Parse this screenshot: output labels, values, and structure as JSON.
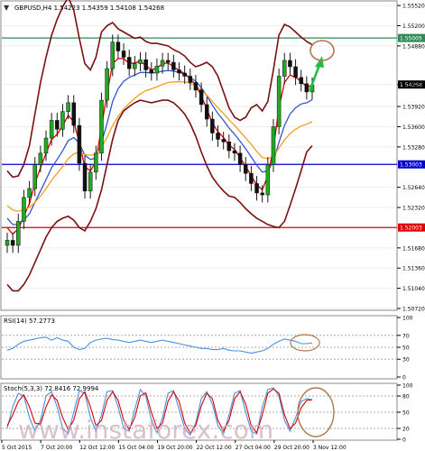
{
  "chart_data": [
    {
      "type": "candlestick",
      "panel": "main",
      "title": "GBPUSD,H4  1.54223 1.54359 1.54108 1.54268",
      "ylim": [
        1.5072,
        1.5555
      ],
      "y_ticks": [
        {
          "label": "1.55520",
          "value": 1.5552
        },
        {
          "label": "1.55200",
          "value": 1.552
        },
        {
          "label": "1.54880",
          "value": 1.5488
        },
        {
          "label": "1.54268",
          "value": 1.54268
        },
        {
          "label": "1.53920",
          "value": 1.5392
        },
        {
          "label": "1.53600",
          "value": 1.536
        },
        {
          "label": "1.53280",
          "value": 1.5328
        },
        {
          "label": "1.52640",
          "value": 1.5264
        },
        {
          "label": "1.52320",
          "value": 1.5232
        },
        {
          "label": "1.51680",
          "value": 1.5168
        },
        {
          "label": "1.51360",
          "value": 1.5136
        },
        {
          "label": "1.51040",
          "value": 1.5104
        },
        {
          "label": "1.50720",
          "value": 1.5072
        }
      ],
      "hlines": [
        {
          "label": "1.55005",
          "value": 1.55005,
          "color": "#2e8b57"
        },
        {
          "label": "1.53003",
          "value": 1.53003,
          "color": "#0000cc"
        },
        {
          "label": "1.52003",
          "value": 1.52003,
          "color": "#dd0000"
        }
      ],
      "current_price": {
        "label": "1.54268",
        "value": 1.54268
      },
      "series": [
        {
          "name": "Close",
          "color": "#006400",
          "values": [
            1.518,
            1.5172,
            1.521,
            1.5248,
            1.5262,
            1.53,
            1.5318,
            1.5342,
            1.537,
            1.5356,
            1.5384,
            1.5398,
            1.5362,
            1.5302,
            1.5258,
            1.5288,
            1.5318,
            1.5402,
            1.5452,
            1.5494,
            1.548,
            1.547,
            1.5452,
            1.546,
            1.5466,
            1.545,
            1.5445,
            1.5456,
            1.5465,
            1.5462,
            1.545,
            1.5445,
            1.544,
            1.543,
            1.5418,
            1.5395,
            1.5372,
            1.535,
            1.534,
            1.5336,
            1.5322,
            1.5318,
            1.53,
            1.5286,
            1.527,
            1.5255,
            1.5252,
            1.53,
            1.536,
            1.544,
            1.5465,
            1.5455,
            1.5438,
            1.5428,
            1.5415,
            1.5426
          ]
        },
        {
          "name": "EMA fast",
          "color": "#dd0000",
          "values": [
            1.52,
            1.519,
            1.5198,
            1.5218,
            1.5238,
            1.527,
            1.5295,
            1.5318,
            1.534,
            1.5348,
            1.5362,
            1.5378,
            1.5368,
            1.5335,
            1.5296,
            1.529,
            1.5305,
            1.536,
            1.5412,
            1.546,
            1.5468,
            1.5468,
            1.546,
            1.5461,
            1.5464,
            1.5457,
            1.545,
            1.5453,
            1.546,
            1.5461,
            1.5455,
            1.5449,
            1.5444,
            1.5436,
            1.5426,
            1.5409,
            1.5388,
            1.5366,
            1.5352,
            1.5343,
            1.5331,
            1.5324,
            1.5311,
            1.5297,
            1.5282,
            1.5268,
            1.526,
            1.5282,
            1.5325,
            1.539,
            1.543,
            1.5442,
            1.5438,
            1.5432,
            1.5423,
            1.5425
          ]
        },
        {
          "name": "EMA medium",
          "color": "#3355cc",
          "values": [
            1.5215,
            1.5205,
            1.5205,
            1.5212,
            1.5222,
            1.524,
            1.5258,
            1.5276,
            1.5295,
            1.5308,
            1.5322,
            1.5338,
            1.5343,
            1.5334,
            1.5315,
            1.5308,
            1.531,
            1.5335,
            1.5365,
            1.54,
            1.542,
            1.5432,
            1.5438,
            1.5442,
            1.5446,
            1.5446,
            1.5445,
            1.5446,
            1.5448,
            1.5449,
            1.5448,
            1.5446,
            1.5443,
            1.5438,
            1.5432,
            1.5422,
            1.5409,
            1.5394,
            1.5381,
            1.537,
            1.5358,
            1.5348,
            1.5337,
            1.5325,
            1.5312,
            1.5299,
            1.5288,
            1.529,
            1.5305,
            1.5335,
            1.5362,
            1.538,
            1.539,
            1.5396,
            1.5398,
            1.5403
          ]
        },
        {
          "name": "EMA slow",
          "color": "#f0a020",
          "values": [
            1.5235,
            1.5228,
            1.5226,
            1.5228,
            1.5232,
            1.524,
            1.525,
            1.5262,
            1.5275,
            1.5286,
            1.5297,
            1.5309,
            1.5317,
            1.532,
            1.5316,
            1.5315,
            1.5316,
            1.5328,
            1.5343,
            1.5362,
            1.5376,
            1.5388,
            1.5397,
            1.5405,
            1.5412,
            1.5417,
            1.542,
            1.5423,
            1.5427,
            1.543,
            1.5431,
            1.5431,
            1.5431,
            1.5429,
            1.5425,
            1.5418,
            1.541,
            1.54,
            1.539,
            1.5381,
            1.5371,
            1.5362,
            1.5352,
            1.5342,
            1.5332,
            1.5321,
            1.5311,
            1.5309,
            1.5313,
            1.5326,
            1.5339,
            1.5349,
            1.5356,
            1.5361,
            1.5364,
            1.5368
          ]
        },
        {
          "name": "Bollinger upper",
          "color": "#7a1010",
          "values": [
            1.529,
            1.528,
            1.5282,
            1.53,
            1.533,
            1.538,
            1.543,
            1.547,
            1.5505,
            1.553,
            1.555,
            1.5565,
            1.5545,
            1.55,
            1.546,
            1.545,
            1.547,
            1.551,
            1.552,
            1.5525,
            1.5515,
            1.551,
            1.5505,
            1.55,
            1.5502,
            1.5495,
            1.5492,
            1.5492,
            1.549,
            1.5488,
            1.5482,
            1.5478,
            1.5472,
            1.5462,
            1.5455,
            1.5458,
            1.5462,
            1.5455,
            1.544,
            1.5415,
            1.539,
            1.5375,
            1.537,
            1.5375,
            1.539,
            1.5395,
            1.5385,
            1.54,
            1.545,
            1.5505,
            1.5522,
            1.5518,
            1.551,
            1.5502,
            1.5495,
            1.549
          ]
        },
        {
          "name": "Bollinger lower",
          "color": "#7a1010",
          "values": [
            1.511,
            1.51,
            1.51,
            1.511,
            1.5125,
            1.5145,
            1.5165,
            1.5185,
            1.52,
            1.521,
            1.5215,
            1.5218,
            1.5212,
            1.52,
            1.5195,
            1.521,
            1.523,
            1.526,
            1.53,
            1.534,
            1.537,
            1.5385,
            1.5392,
            1.5398,
            1.5402,
            1.54,
            1.5398,
            1.54,
            1.5402,
            1.5402,
            1.5398,
            1.539,
            1.538,
            1.5365,
            1.5345,
            1.532,
            1.5298,
            1.528,
            1.5268,
            1.5258,
            1.525,
            1.5248,
            1.524,
            1.523,
            1.5222,
            1.5215,
            1.521,
            1.5205,
            1.5202,
            1.52,
            1.521,
            1.5235,
            1.5262,
            1.529,
            1.532,
            1.533
          ]
        }
      ],
      "x_tick_labels": [
        "5 Oct 2015",
        "7 Oct 20:00",
        "12 Oct 12:00",
        "15 Oct 04:00",
        "19 Oct 20:00",
        "22 Oct 12:00",
        "27 Oct 04:00",
        "29 Oct 20:00",
        "3 Nov 12:00"
      ],
      "watermark": "www.instaforex.com"
    },
    {
      "type": "line",
      "panel": "rsi",
      "title": "RSI(14) 57.2773",
      "ylim": [
        0,
        100
      ],
      "y_ticks": [
        {
          "label": "100",
          "value": 100
        },
        {
          "label": "70",
          "value": 70
        },
        {
          "label": "50",
          "value": 50
        },
        {
          "label": "30",
          "value": 30
        },
        {
          "label": "0",
          "value": 0
        }
      ],
      "series": [
        {
          "name": "RSI",
          "color": "#4a90e2",
          "values": [
            45,
            48,
            55,
            60,
            62,
            64,
            66,
            67,
            62,
            66,
            62,
            60,
            50,
            46,
            48,
            58,
            62,
            64,
            65,
            63,
            62,
            60,
            58,
            60,
            62,
            60,
            58,
            60,
            62,
            60,
            58,
            56,
            54,
            52,
            50,
            48,
            48,
            46,
            46,
            48,
            45,
            44,
            44,
            42,
            40,
            42,
            44,
            48,
            55,
            60,
            64,
            62,
            60,
            56,
            56,
            57.3
          ]
        }
      ]
    },
    {
      "type": "line",
      "panel": "stochastic",
      "title": "Stoch(5,3,3) 72.8416 72.9994",
      "ylim": [
        0,
        100
      ],
      "y_ticks": [
        {
          "label": "100",
          "value": 100
        },
        {
          "label": "80",
          "value": 80
        },
        {
          "label": "50",
          "value": 50
        },
        {
          "label": "20",
          "value": 20
        },
        {
          "label": "0",
          "value": 0
        }
      ],
      "series": [
        {
          "name": "%K",
          "color": "#4a90e2",
          "values": [
            20,
            60,
            85,
            80,
            40,
            15,
            35,
            80,
            88,
            60,
            20,
            10,
            50,
            90,
            85,
            40,
            15,
            45,
            88,
            90,
            60,
            20,
            15,
            55,
            92,
            80,
            35,
            12,
            40,
            85,
            90,
            55,
            20,
            8,
            30,
            75,
            88,
            65,
            25,
            10,
            45,
            85,
            90,
            50,
            15,
            10,
            60,
            92,
            95,
            80,
            35,
            15,
            40,
            70,
            75,
            72.8
          ]
        },
        {
          "name": "%D",
          "color": "#dd0000",
          "values": [
            25,
            45,
            70,
            82,
            60,
            30,
            28,
            60,
            82,
            72,
            40,
            18,
            35,
            75,
            88,
            60,
            25,
            35,
            72,
            88,
            72,
            35,
            18,
            40,
            80,
            86,
            50,
            20,
            30,
            70,
            88,
            70,
            30,
            12,
            25,
            62,
            85,
            75,
            35,
            15,
            35,
            75,
            88,
            65,
            25,
            12,
            45,
            85,
            93,
            85,
            45,
            20,
            30,
            58,
            72,
            73.0
          ]
        }
      ]
    }
  ]
}
